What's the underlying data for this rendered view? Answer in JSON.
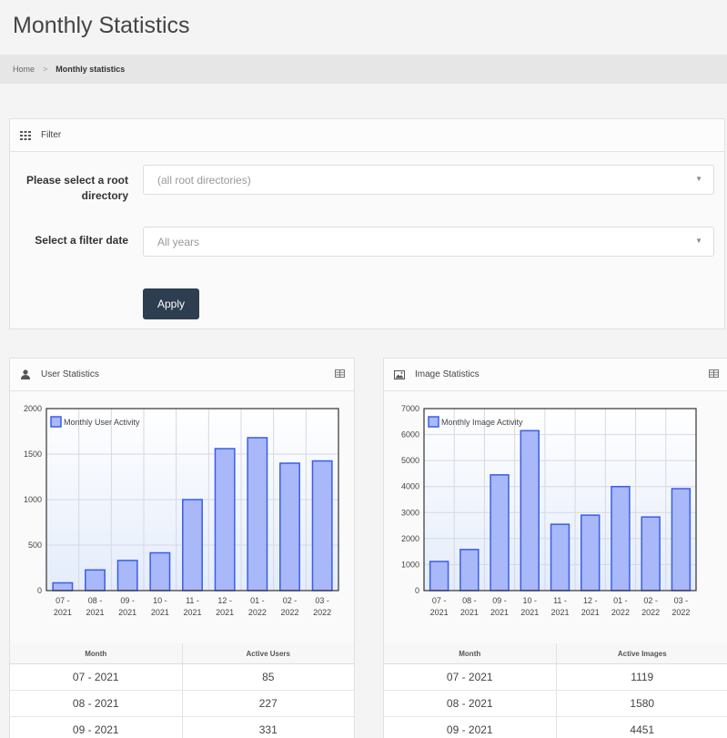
{
  "page": {
    "title": "Monthly Statistics"
  },
  "breadcrumb": {
    "home": "Home",
    "separator": ">",
    "current": "Monthly statistics"
  },
  "filter": {
    "title": "Filter",
    "root_label": "Please select a root directory",
    "root_value": "(all root directories)",
    "date_label": "Select a filter date",
    "date_value": "All years",
    "apply_label": "Apply"
  },
  "icons": {
    "filter": "grid-icon",
    "user": "user-icon",
    "image": "image-icon",
    "menu": "table-menu-icon",
    "caret": "caret-down-icon"
  },
  "colors": {
    "bar_fill": "#a8b8f8",
    "bar_stroke": "#3a5de8",
    "button": "#2c3e50"
  },
  "user_stats": {
    "title": "User Statistics",
    "col_month": "Month",
    "col_value": "Active Users",
    "rows": [
      {
        "month": "07 - 2021",
        "value": "85"
      },
      {
        "month": "08 - 2021",
        "value": "227"
      },
      {
        "month": "09 - 2021",
        "value": "331"
      }
    ]
  },
  "image_stats": {
    "title": "Image Statistics",
    "col_month": "Month",
    "col_value": "Active Images",
    "rows": [
      {
        "month": "07 - 2021",
        "value": "1119"
      },
      {
        "month": "08 - 2021",
        "value": "1580"
      },
      {
        "month": "09 - 2021",
        "value": "4451"
      }
    ]
  },
  "chart_data": [
    {
      "type": "bar",
      "categories": [
        "07 - 2021",
        "08 - 2021",
        "09 - 2021",
        "10 - 2021",
        "11 - 2021",
        "12 - 2021",
        "01 - 2022",
        "02 - 2022",
        "03 - 2022"
      ],
      "series": [
        {
          "name": "Monthly User Activity",
          "values": [
            85,
            227,
            331,
            415,
            1000,
            1560,
            1680,
            1400,
            1425
          ]
        }
      ],
      "ylim": [
        0,
        2000
      ],
      "yticks": [
        0,
        500,
        1000,
        1500,
        2000
      ],
      "grid": true,
      "legend": "top-left"
    },
    {
      "type": "bar",
      "categories": [
        "07 - 2021",
        "08 - 2021",
        "09 - 2021",
        "10 - 2021",
        "11 - 2021",
        "12 - 2021",
        "01 - 2022",
        "02 - 2022",
        "03 - 2022"
      ],
      "series": [
        {
          "name": "Monthly Image Activity",
          "values": [
            1119,
            1580,
            4451,
            6150,
            2550,
            2900,
            4000,
            2830,
            3920
          ]
        }
      ],
      "ylim": [
        0,
        7000
      ],
      "yticks": [
        0,
        1000,
        2000,
        3000,
        4000,
        5000,
        6000,
        7000
      ],
      "grid": true,
      "legend": "top-left"
    }
  ]
}
